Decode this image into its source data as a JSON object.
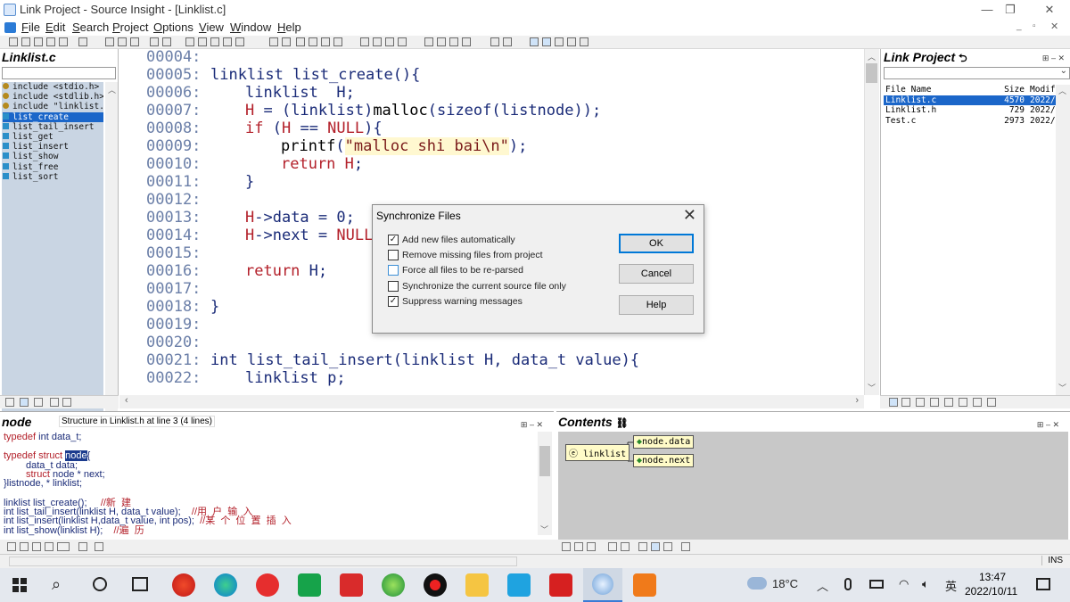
{
  "window": {
    "title": "Link Project - Source Insight - [Linklist.c]"
  },
  "menu": [
    "File",
    "Edit",
    "Search",
    "Project",
    "Options",
    "View",
    "Window",
    "Help"
  ],
  "left_panel": {
    "title": "Linklist.c",
    "symbols": [
      {
        "label": "include <stdio.h>",
        "kind": "include"
      },
      {
        "label": "include <stdlib.h>",
        "kind": "include"
      },
      {
        "label": "include \"linklist.",
        "kind": "include"
      },
      {
        "label": "list_create",
        "kind": "function",
        "selected": true
      },
      {
        "label": "list_tail_insert",
        "kind": "function"
      },
      {
        "label": "list_get",
        "kind": "function"
      },
      {
        "label": "list_insert",
        "kind": "function"
      },
      {
        "label": "list_show",
        "kind": "function"
      },
      {
        "label": "list_free",
        "kind": "function"
      },
      {
        "label": "list_sort",
        "kind": "function"
      }
    ]
  },
  "editor": {
    "line_numbers": [
      "00004:",
      "00005:",
      "00006:",
      "00007:",
      "00008:",
      "00009:",
      "00010:",
      "00011:",
      "00012:",
      "00013:",
      "00014:",
      "00015:",
      "00016:",
      "00017:",
      "00018:",
      "00019:",
      "00020:",
      "00021:",
      "00022:"
    ]
  },
  "right_panel": {
    "title": "Link Project",
    "columns": [
      "File Name",
      "Size",
      "Modif"
    ],
    "files": [
      {
        "name": "Linklist.c",
        "size": "4570",
        "modified": "2022/",
        "selected": true
      },
      {
        "name": "Linklist.h",
        "size": "729",
        "modified": "2022/"
      },
      {
        "name": "Test.c",
        "size": "2973",
        "modified": "2022/"
      }
    ]
  },
  "bottom_left": {
    "title": "node",
    "context": "Structure in Linklist.h at line 3 (4 lines)"
  },
  "bottom_right": {
    "title": "Contents",
    "graph": {
      "root": "linklist",
      "children": [
        "node.data",
        "node.next"
      ]
    }
  },
  "dialog": {
    "title": "Synchronize Files",
    "options": [
      {
        "label": "Add new files automatically",
        "checked": true
      },
      {
        "label": "Remove missing files from project",
        "checked": false
      },
      {
        "label": "Force all files to be re-parsed",
        "checked": false
      },
      {
        "label": "Synchronize the current source file only",
        "checked": false
      },
      {
        "label": "Suppress warning messages",
        "checked": true
      }
    ],
    "buttons": {
      "ok": "OK",
      "cancel": "Cancel",
      "help": "Help"
    }
  },
  "status": {
    "mode": "INS"
  },
  "taskbar": {
    "temperature": "18°C",
    "ime": "英",
    "time": "13:47",
    "date": "2022/10/11"
  }
}
